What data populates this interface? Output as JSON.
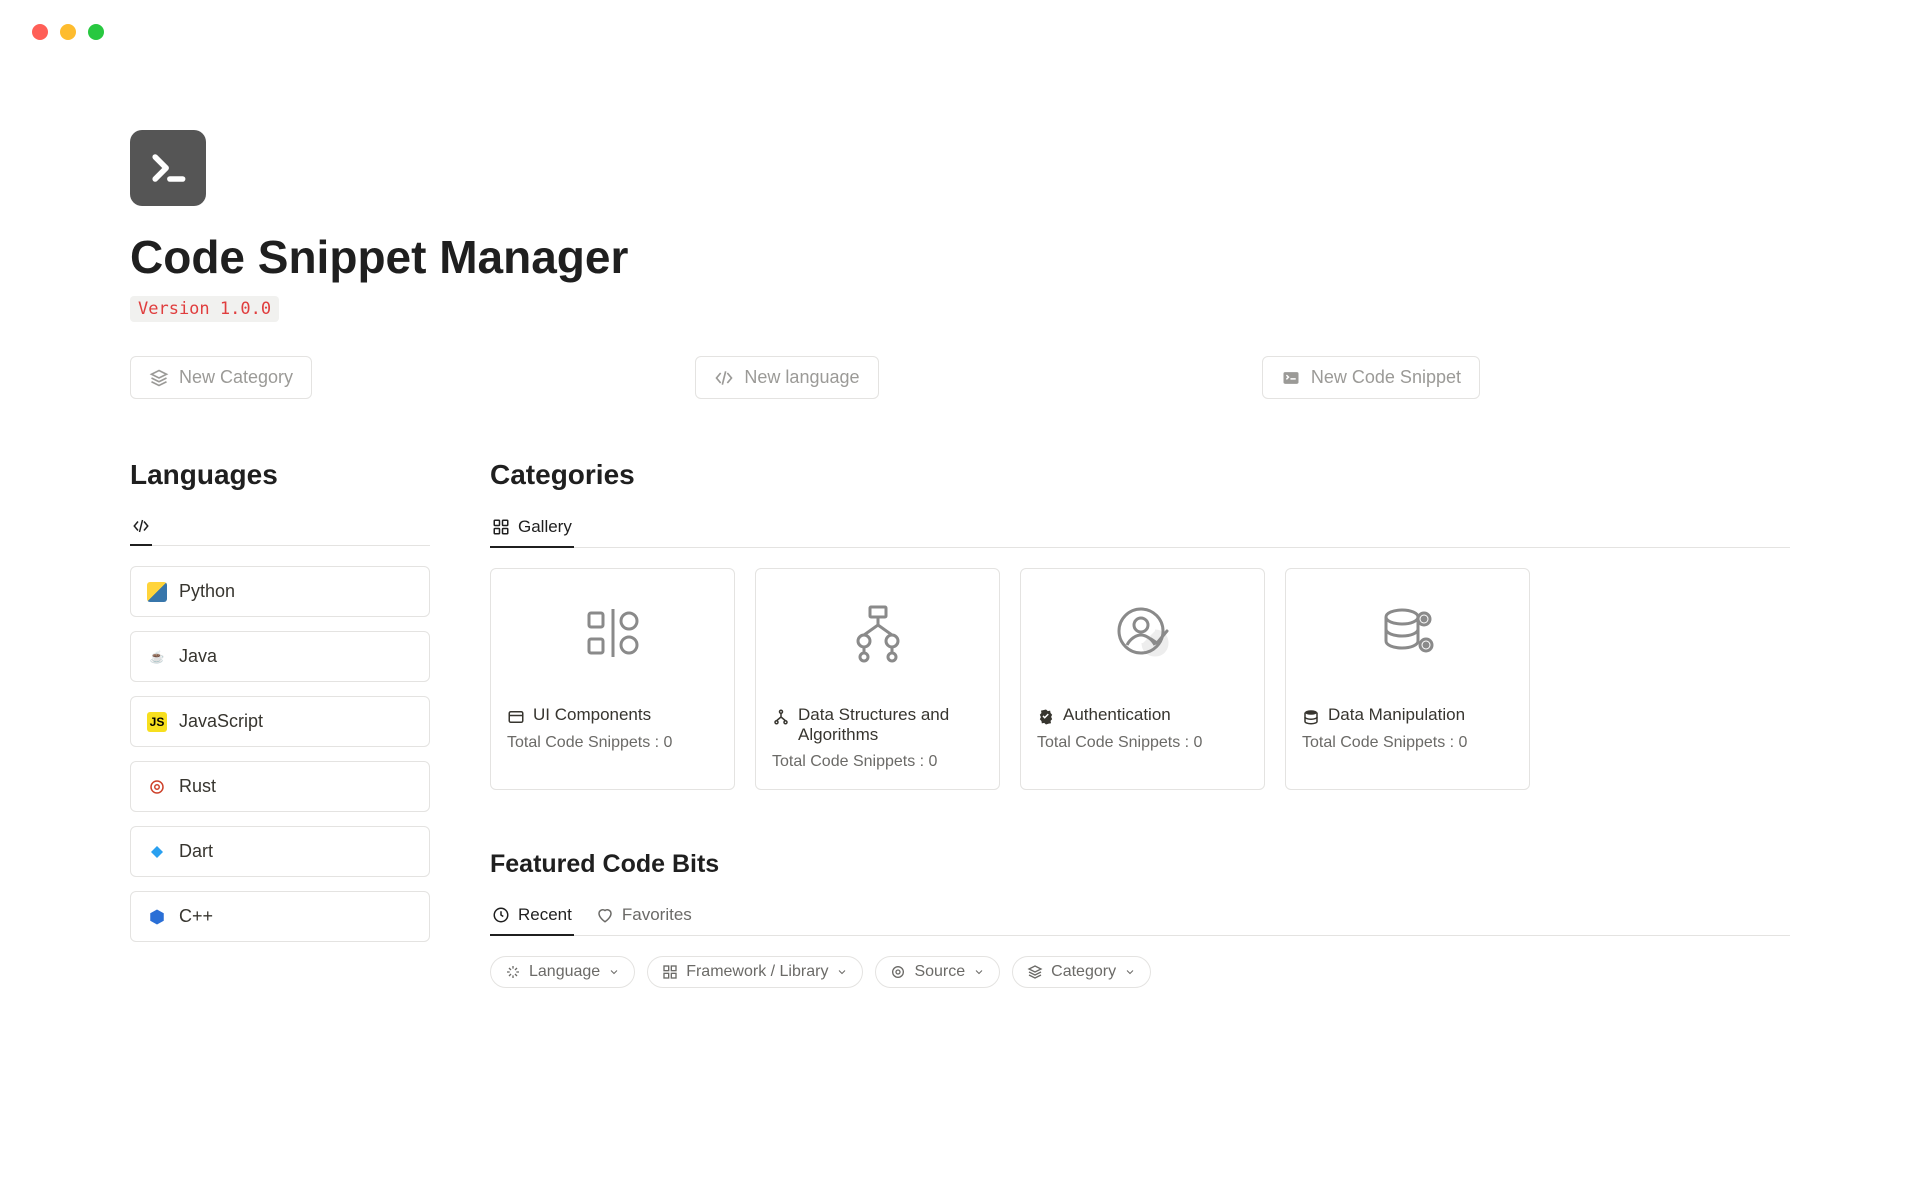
{
  "window": {
    "controls": [
      "close",
      "minimize",
      "maximize"
    ]
  },
  "header": {
    "title": "Code Snippet Manager",
    "version_label": "Version 1.0.0"
  },
  "actions": {
    "new_category": "New Category",
    "new_language": "New language",
    "new_snippet": "New Code Snippet"
  },
  "languages": {
    "title": "Languages",
    "tab_icon": "code-icon",
    "items": [
      {
        "name": "Python",
        "icon": "python-icon",
        "color": "#ffd43b"
      },
      {
        "name": "Java",
        "icon": "java-icon",
        "color": "#fbe9e7"
      },
      {
        "name": "JavaScript",
        "icon": "js-icon",
        "color": "#f7df1e"
      },
      {
        "name": "Rust",
        "icon": "rust-icon",
        "color": "#e1d7ff"
      },
      {
        "name": "Dart",
        "icon": "dart-icon",
        "color": "#d6ecff"
      },
      {
        "name": "C++",
        "icon": "cpp-icon",
        "color": "#d6e4ff"
      }
    ]
  },
  "categories": {
    "title": "Categories",
    "tabs": [
      {
        "label": "Gallery",
        "icon": "gallery-icon",
        "active": true
      }
    ],
    "meta_label": "Total Code Snippets : 0",
    "items": [
      {
        "name": "UI Components",
        "icon": "ui-components-icon",
        "meta": "Total Code Snippets : 0"
      },
      {
        "name": "Data Structures and Algorithms",
        "icon": "dsa-icon",
        "meta": "Total Code Snippets : 0"
      },
      {
        "name": "Authentication",
        "icon": "auth-icon",
        "meta": "Total Code Snippets : 0"
      },
      {
        "name": "Data Manipulation",
        "icon": "data-manipulation-icon",
        "meta": "Total Code Snippets : 0"
      }
    ]
  },
  "featured": {
    "title": "Featured Code Bits",
    "tabs": [
      {
        "label": "Recent",
        "icon": "clock-icon",
        "active": true
      },
      {
        "label": "Favorites",
        "icon": "heart-icon",
        "active": false
      }
    ],
    "filters": [
      {
        "label": "Language",
        "icon": "sparkle-icon"
      },
      {
        "label": "Framework / Library",
        "icon": "grid-icon"
      },
      {
        "label": "Source",
        "icon": "target-icon"
      },
      {
        "label": "Category",
        "icon": "layers-icon"
      }
    ]
  }
}
